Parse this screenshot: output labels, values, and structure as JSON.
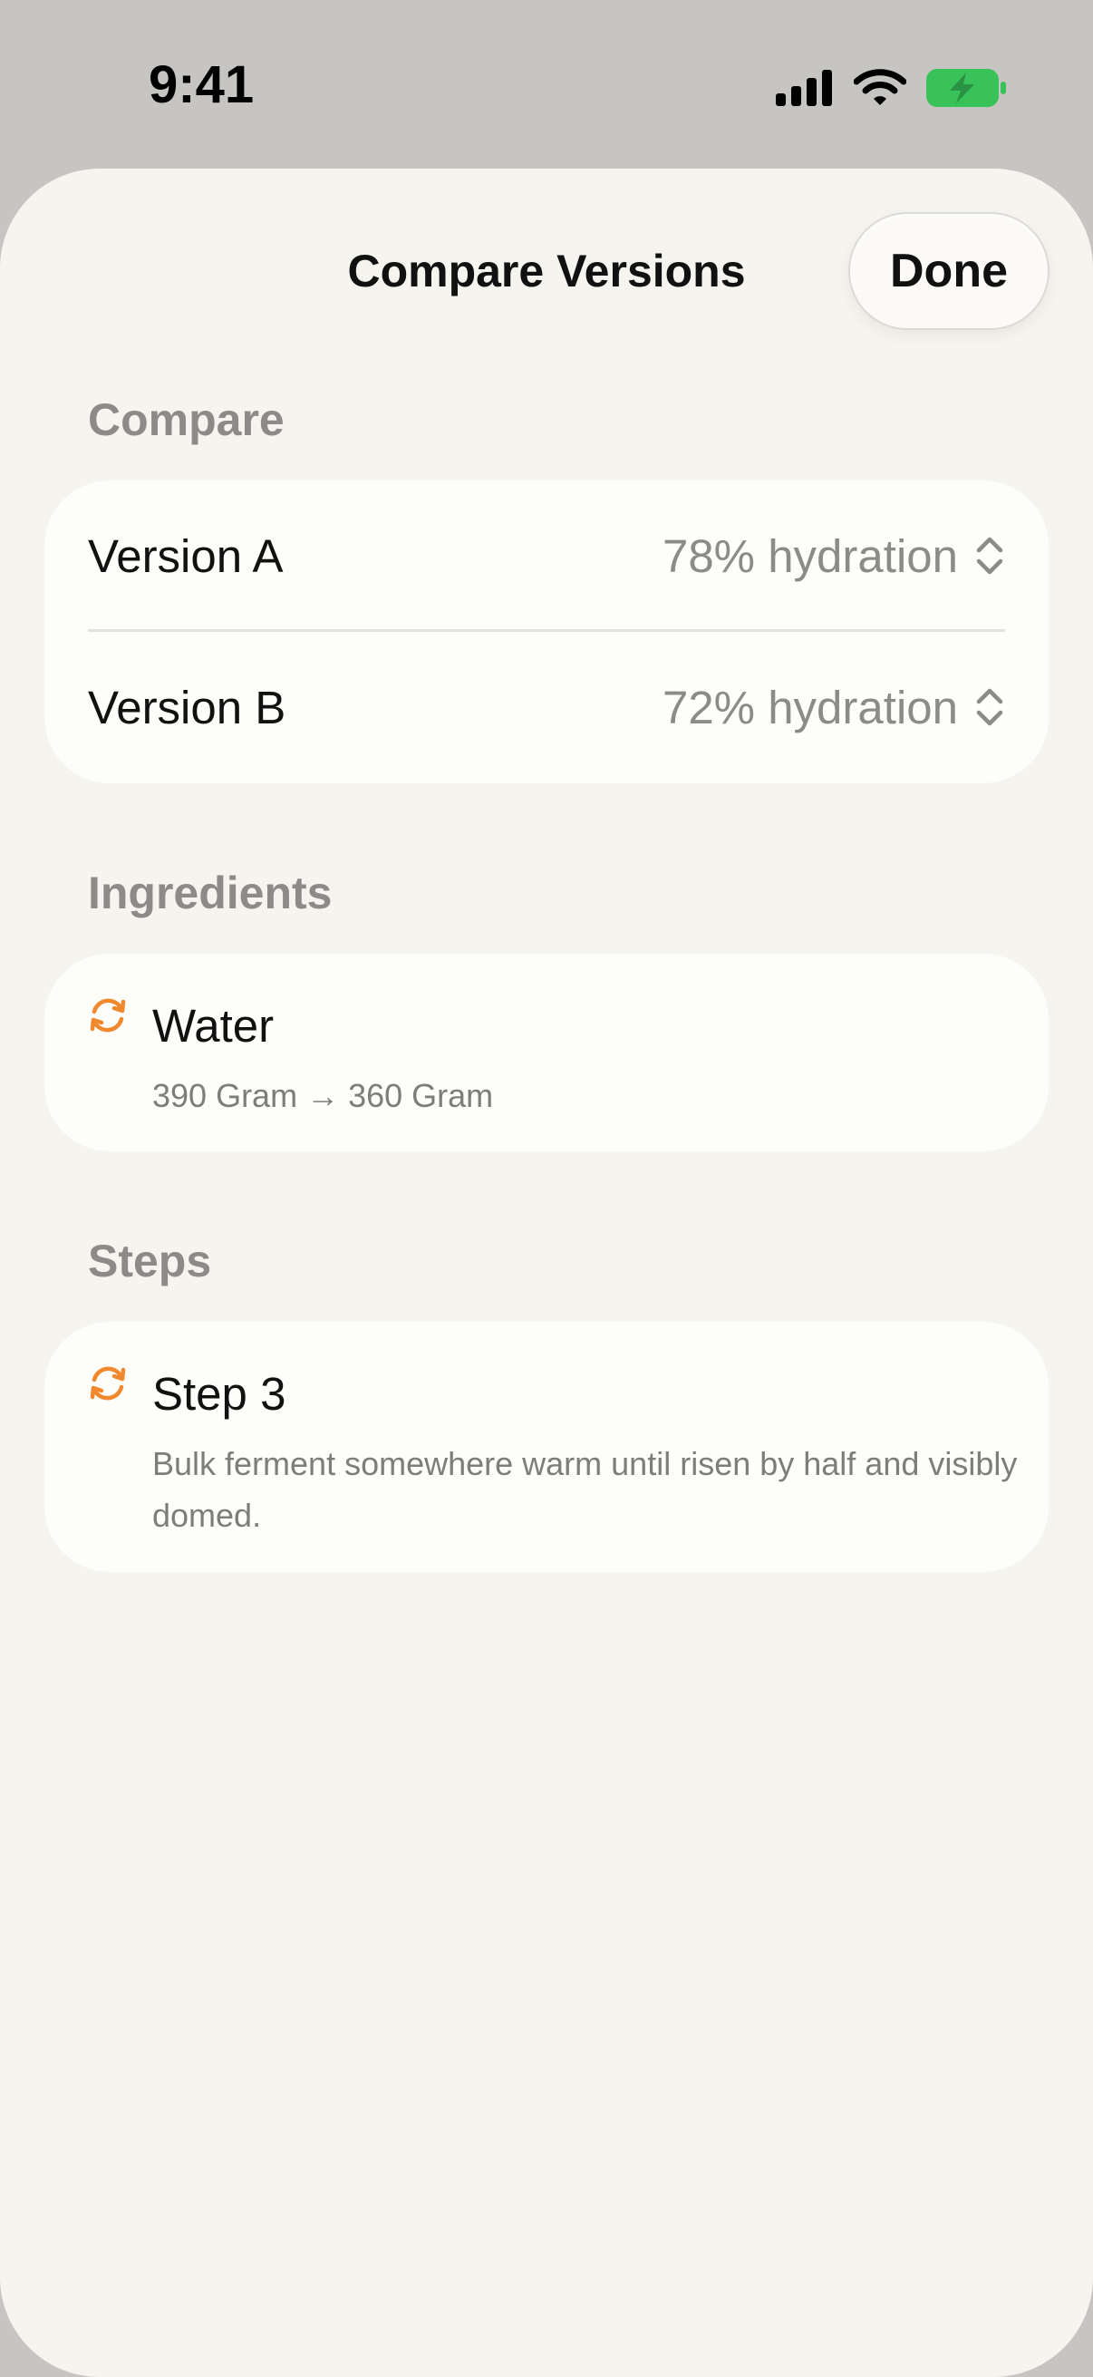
{
  "status_bar": {
    "time": "9:41",
    "icons": [
      "cellular-signal-icon",
      "wifi-icon",
      "battery-charging-icon"
    ],
    "battery_color": "#3ac25a"
  },
  "sheet": {
    "title": "Compare Versions",
    "done_label": "Done"
  },
  "compare": {
    "header": "Compare",
    "versions": [
      {
        "label": "Version A",
        "value": "78% hydration"
      },
      {
        "label": "Version B",
        "value": "72% hydration"
      }
    ]
  },
  "ingredients": {
    "header": "Ingredients",
    "items": [
      {
        "icon": "change-cycle-icon",
        "name": "Water",
        "detail": "390 Gram → 360 Gram"
      }
    ]
  },
  "steps": {
    "header": "Steps",
    "items": [
      {
        "icon": "change-cycle-icon",
        "name": "Step 3",
        "detail": "Bulk ferment somewhere warm until risen by half and visibly domed."
      }
    ]
  },
  "colors": {
    "accent": "#f0892d",
    "sheet_background": "#f6f4ef",
    "card_background": "#fdfdf9",
    "secondary_text": "#8c8b87"
  }
}
